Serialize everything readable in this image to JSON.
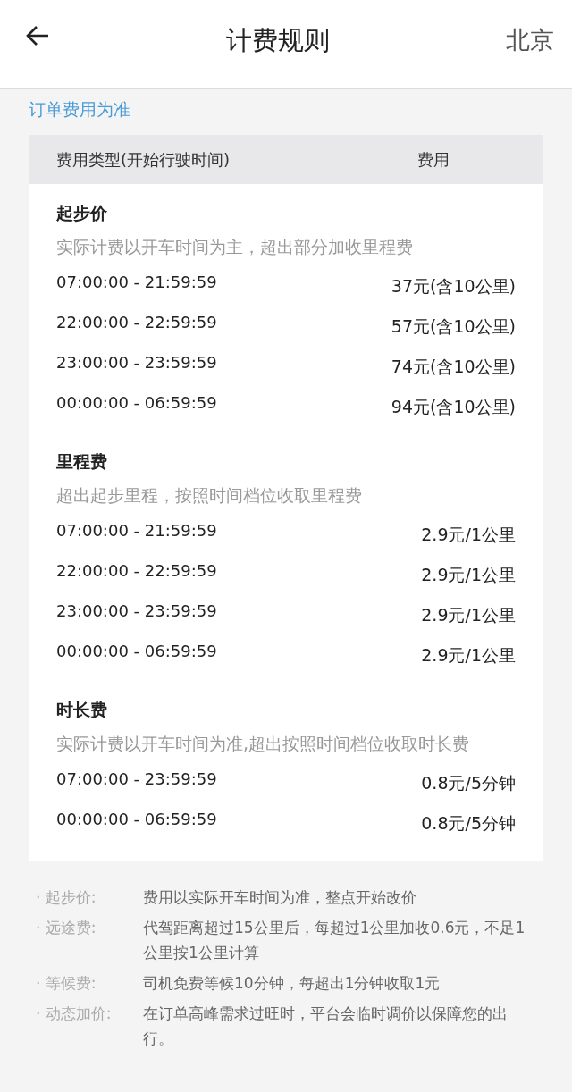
{
  "header": {
    "title": "计费规则",
    "city": "北京"
  },
  "notice": "订单费用为准",
  "table": {
    "columns": [
      "费用类型(开始行驶时间)",
      "费用"
    ],
    "sections": [
      {
        "title": "起步价",
        "description": "实际计费以开车时间为主，超出部分加收里程费",
        "rows": [
          {
            "time": "07:00:00 - 21:59:59",
            "fee": "37元(含10公里)"
          },
          {
            "time": "22:00:00 - 22:59:59",
            "fee": "57元(含10公里)"
          },
          {
            "time": "23:00:00 - 23:59:59",
            "fee": "74元(含10公里)"
          },
          {
            "time": "00:00:00 - 06:59:59",
            "fee": "94元(含10公里)"
          }
        ]
      },
      {
        "title": "里程费",
        "description": "超出起步里程，按照时间档位收取里程费",
        "rows": [
          {
            "time": "07:00:00 - 21:59:59",
            "fee": "2.9元/1公里"
          },
          {
            "time": "22:00:00 - 22:59:59",
            "fee": "2.9元/1公里"
          },
          {
            "time": "23:00:00 - 23:59:59",
            "fee": "2.9元/1公里"
          },
          {
            "time": "00:00:00 - 06:59:59",
            "fee": "2.9元/1公里"
          }
        ]
      },
      {
        "title": "时长费",
        "description": "实际计费以开车时间为准,超出按照时间档位收取时长费",
        "rows": [
          {
            "time": "07:00:00 - 23:59:59",
            "fee": "0.8元/5分钟"
          },
          {
            "time": "00:00:00 - 06:59:59",
            "fee": "0.8元/5分钟"
          }
        ]
      }
    ]
  },
  "notes": [
    {
      "label": "· 起步价:",
      "text": "费用以实际开车时间为准，整点开始改价"
    },
    {
      "label": "· 远途费:",
      "text": "代驾距离超过15公里后，每超过1公里加收0.6元，不足1公里按1公里计算"
    },
    {
      "label": "· 等候费:",
      "text": "司机免费等候10分钟，每超出1分钟收取1元"
    },
    {
      "label": "· 动态加价:",
      "text": "在订单高峰需求过旺时，平台会临时调价以保障您的出行。"
    }
  ]
}
